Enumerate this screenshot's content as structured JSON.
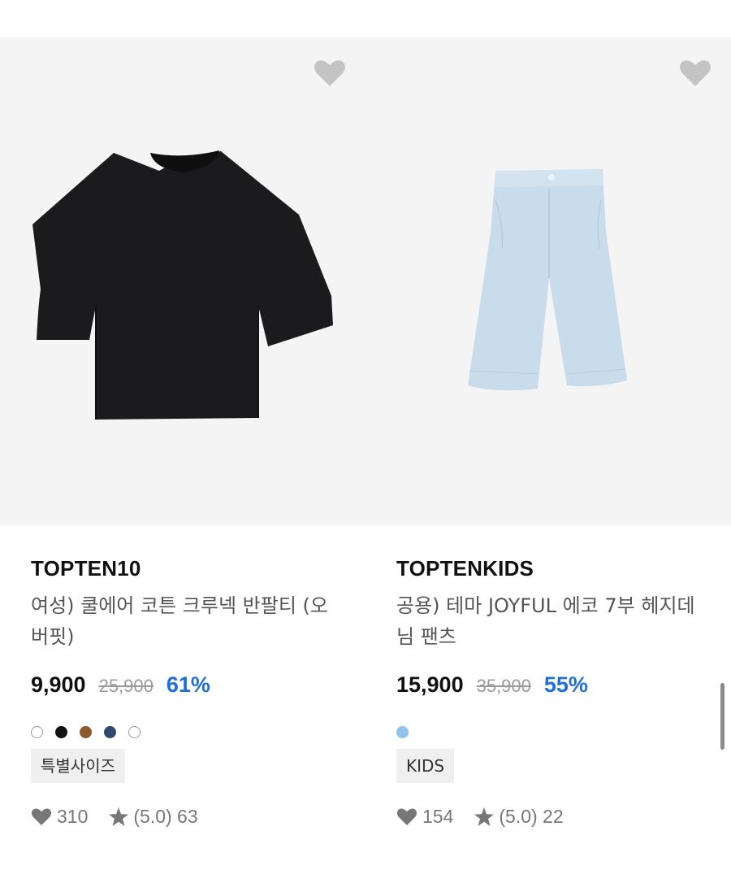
{
  "products": [
    {
      "brand": "TOPTEN10",
      "name": "여성) 쿨에어 코튼 크루넥 반팔티 (오버핏)",
      "price": "9,900",
      "original_price": "25,900",
      "discount": "61%",
      "colors": [
        "#ffffff",
        "#111111",
        "#8a5a2b",
        "#2f4a6e",
        "#ffffff"
      ],
      "tag": "특별사이즈",
      "likes": "310",
      "rating": "(5.0) 63",
      "image_icon": "black-tshirt-image"
    },
    {
      "brand": "TOPTENKIDS",
      "name": "공용) 테마 JOYFUL 에코 7부 헤지데님 팬츠",
      "price": "15,900",
      "original_price": "35,900",
      "discount": "55%",
      "colors": [
        "#8ec4ec"
      ],
      "tag": "KIDS",
      "likes": "154",
      "rating": "(5.0) 22",
      "image_icon": "light-denim-shorts-image"
    }
  ],
  "icons": {
    "wishlist": "heart-icon",
    "likes": "heart-icon",
    "rating": "star-icon"
  },
  "theme": {
    "accent": "#1f6fd6",
    "image_bg": "#f4f4f4",
    "heart_gray": "#c4c4c4"
  }
}
